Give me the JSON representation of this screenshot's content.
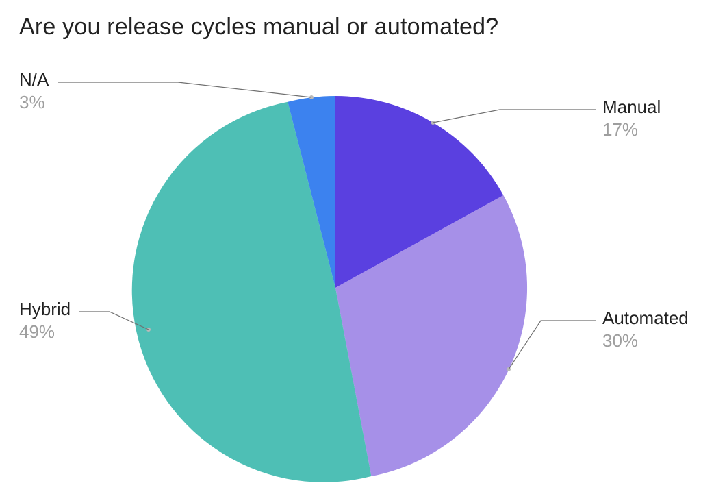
{
  "title": "Are you release cycles manual or automated?",
  "chart_data": {
    "type": "pie",
    "title": "Are you release cycles manual or automated?",
    "slices": [
      {
        "label": "Manual",
        "value": 17,
        "pct": "17%",
        "color": "#5a40e0"
      },
      {
        "label": "Automated",
        "value": 30,
        "pct": "30%",
        "color": "#a690e8"
      },
      {
        "label": "Hybrid",
        "value": 49,
        "pct": "49%",
        "color": "#4ebfb5"
      },
      {
        "label": "N/A",
        "value": 3,
        "pct": "3%",
        "color": "#3c82ef"
      }
    ]
  },
  "labels": {
    "manual": {
      "name": "Manual",
      "pct": "17%"
    },
    "automated": {
      "name": "Automated",
      "pct": "30%"
    },
    "hybrid": {
      "name": "Hybrid",
      "pct": "49%"
    },
    "na": {
      "name": "N/A",
      "pct": "3%"
    }
  }
}
